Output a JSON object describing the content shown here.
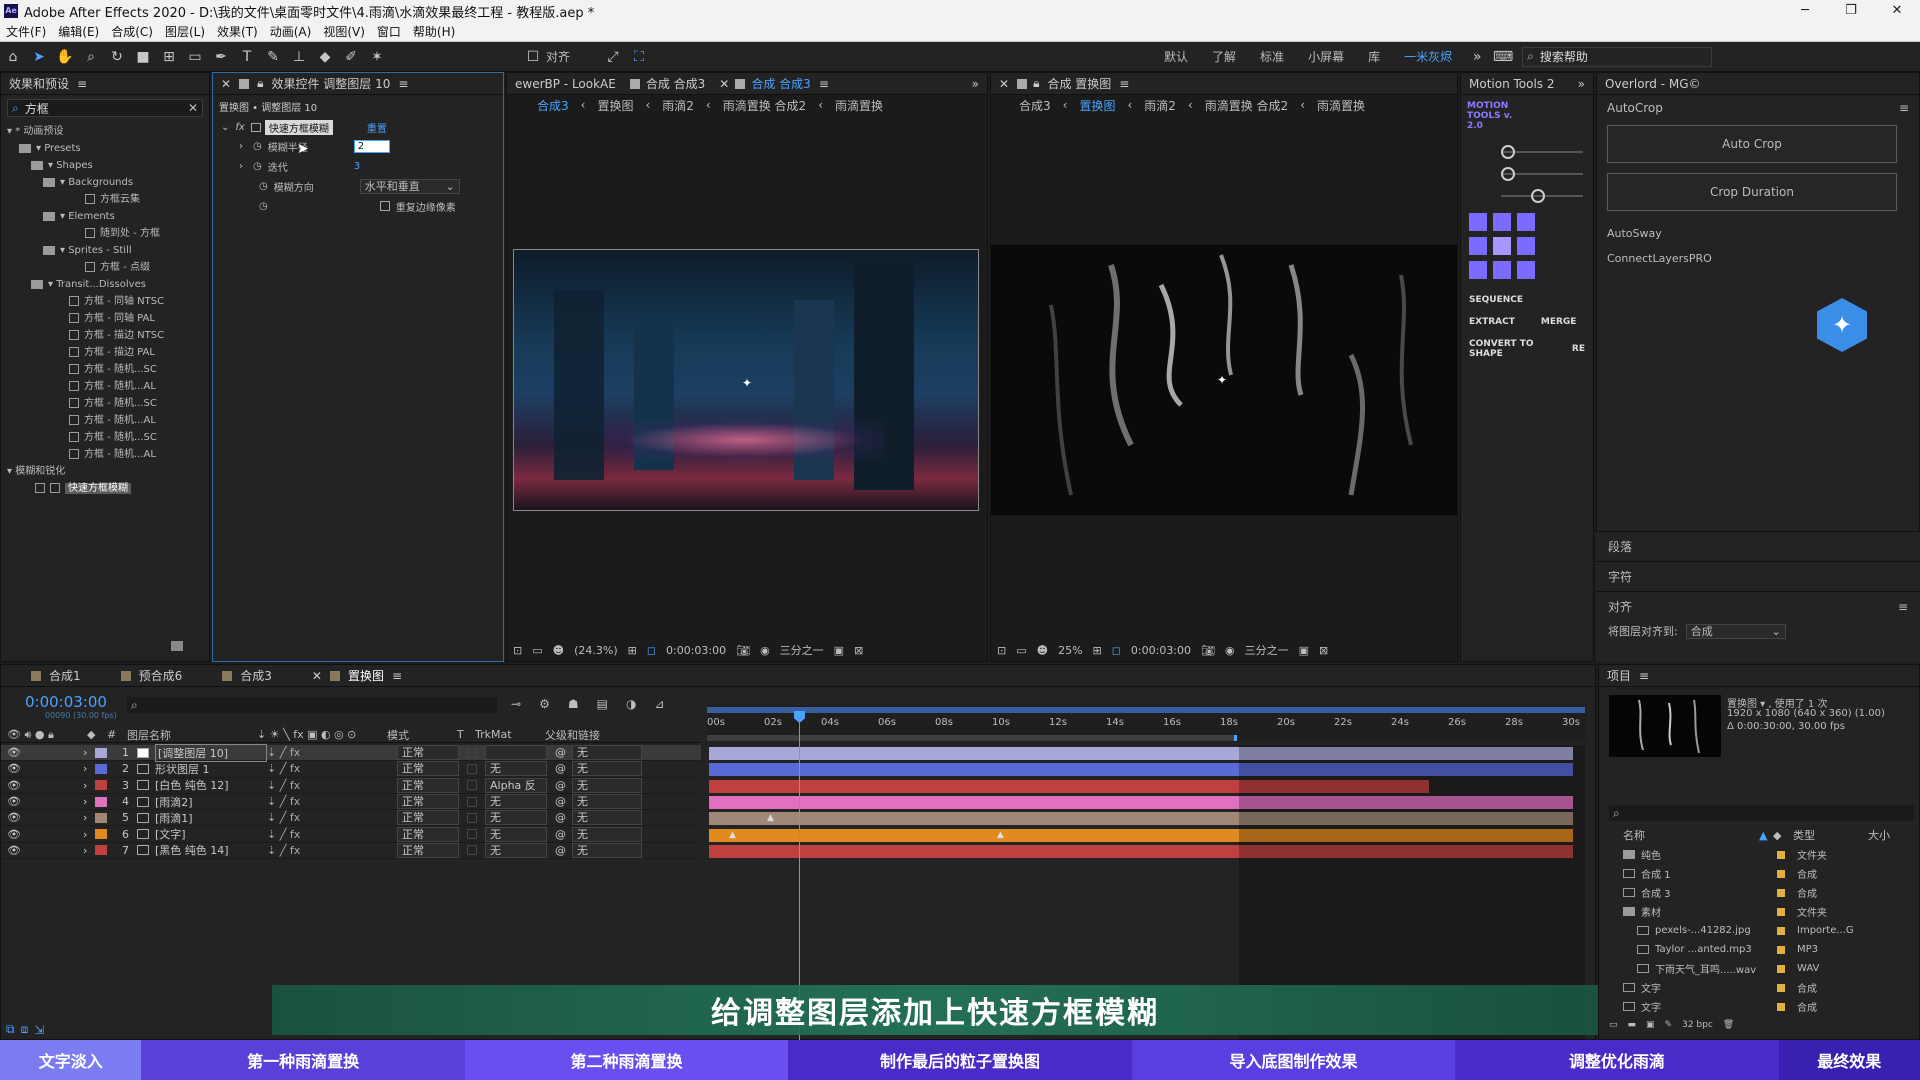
{
  "app": {
    "title": "Adobe After Effects 2020 - D:\\我的文件\\桌面零时文件\\4.雨滴\\水滴效果最终工程 - 教程版.aep *",
    "logo": "Ae"
  },
  "menu": [
    "文件(F)",
    "编辑(E)",
    "合成(C)",
    "图层(L)",
    "效果(T)",
    "动画(A)",
    "视图(V)",
    "窗口",
    "帮助(H)"
  ],
  "toolbar": {
    "align_label": "对齐",
    "workspaces": [
      "默认",
      "了解",
      "标准",
      "小屏幕",
      "库",
      "一米灰烬"
    ],
    "active_workspace": "一米灰烬",
    "search_placeholder": "搜索帮助"
  },
  "effects_panel": {
    "title": "效果和预设",
    "search_value": "方框",
    "tree": [
      "▾ * 动画预设",
      "▾ Presets",
      "▾ Shapes",
      "▾ Backgrounds",
      "方框云集",
      "▾ Elements",
      "随到处 - 方框",
      "▾ Sprites - Still",
      "方框 - 点缀",
      "▾ Transit...Dissolves",
      "方框 - 同轴 NTSC",
      "方框 - 同轴 PAL",
      "方框 - 描边 NTSC",
      "方框 - 描边 PAL",
      "方框 - 随机...SC",
      "方框 - 随机...AL",
      "方框 - 随机...SC",
      "方框 - 随机...AL",
      "方框 - 随机...SC",
      "方框 - 随机...AL",
      "▾ 模糊和锐化",
      "快速方框模糊"
    ]
  },
  "effect_controls": {
    "tab": "效果控件 调整图层 10",
    "path": "置换图 • 调整图层 10",
    "effect_name": "快速方框模糊",
    "reset": "重置",
    "props": [
      {
        "name": "模糊半径",
        "value": "2"
      },
      {
        "name": "迭代",
        "value": "3"
      },
      {
        "name": "模糊方向",
        "value": "水平和垂直"
      },
      {
        "name": "",
        "value": "重复边缘像素"
      }
    ]
  },
  "comp_viewer1": {
    "tabs": [
      "ewerBP - LookAE",
      "合成 合成3",
      "合成 合成3"
    ],
    "flow": [
      "合成3",
      "置换图",
      "雨滴2",
      "雨滴置换 合成2",
      "雨滴置换"
    ],
    "zoom": "(24.3%)",
    "time": "0:00:03:00",
    "res": "三分之一"
  },
  "comp_viewer2": {
    "tab": "合成 置换图",
    "flow": [
      "合成3",
      "置换图",
      "雨滴2",
      "雨滴置换 合成2",
      "雨滴置换"
    ],
    "zoom": "25%",
    "time": "0:00:03:00",
    "res": "三分之一"
  },
  "motion_tools": {
    "tab": "Motion Tools 2",
    "logo": "MOTION TOOLS v. 2.0",
    "buttons": [
      "SEQUENCE",
      "EXTRACT",
      "MERGE",
      "CONVERT TO SHAPE",
      "RE"
    ]
  },
  "overlord": {
    "tab": "Overlord - MG©",
    "autocrop": "AutoCrop",
    "btn1": "Auto Crop",
    "btn2": "Crop Duration",
    "items": [
      "AutoSway",
      "ConnectLayersPRO"
    ]
  },
  "right_panels": {
    "p1": "段落",
    "p2": "字符",
    "p3": "对齐",
    "align_to_label": "将图层对齐到:",
    "align_to_value": "合成"
  },
  "timeline": {
    "tabs": [
      "合成1",
      "预合成6",
      "合成3",
      "置换图"
    ],
    "timecode": "0:00:03:00",
    "frames": "00090 (30.00 fps)",
    "headers": [
      "图层名称",
      "模式",
      "T",
      "TrkMat",
      "父级和链接"
    ],
    "ruler": [
      "00s",
      "02s",
      "04s",
      "06s",
      "08s",
      "10s",
      "12s",
      "14s",
      "16s",
      "18s",
      "20s",
      "22s",
      "24s",
      "26s",
      "28s",
      "30s"
    ],
    "layers": [
      {
        "n": "1",
        "name": "[调整图层 10]",
        "mode": "正常",
        "trk": "",
        "parent": "无",
        "color": "#a8a8d8"
      },
      {
        "n": "2",
        "name": "形状图层 1",
        "mode": "正常",
        "trk": "无",
        "parent": "无",
        "color": "#5a6bd8"
      },
      {
        "n": "3",
        "name": "[白色 纯色 12]",
        "mode": "正常",
        "trk": "Alpha 反",
        "parent": "无",
        "color": "#c04040"
      },
      {
        "n": "4",
        "name": "[雨滴2]",
        "mode": "正常",
        "trk": "无",
        "parent": "无",
        "color": "#e070c0"
      },
      {
        "n": "5",
        "name": "[雨滴1]",
        "mode": "正常",
        "trk": "无",
        "parent": "无",
        "color": "#a08878"
      },
      {
        "n": "6",
        "name": "[文字]",
        "mode": "正常",
        "trk": "无",
        "parent": "无",
        "color": "#e08a20"
      },
      {
        "n": "7",
        "name": "[黑色 纯色 14]",
        "mode": "正常",
        "trk": "无",
        "parent": "无",
        "color": "#c04040"
      }
    ]
  },
  "project": {
    "tab": "项目",
    "item": "置换图 ▾ , 使用了 1 次",
    "info1": "1920 x 1080 (640 x 360) (1.00)",
    "info2": "Δ 0:00:30:00, 30.00 fps",
    "cols": [
      "名称",
      "类型",
      "大小"
    ],
    "items": [
      {
        "name": "纯色",
        "type": "文件夹"
      },
      {
        "name": "合成 1",
        "type": "合成"
      },
      {
        "name": "合成 3",
        "type": "合成"
      },
      {
        "name": "素材",
        "type": "文件夹"
      },
      {
        "name": "pexels-...41282.jpg",
        "type": "Importe...G"
      },
      {
        "name": "Taylor ...anted.mp3",
        "type": "MP3"
      },
      {
        "name": "下雨天气_耳鸣.....wav",
        "type": "WAV"
      },
      {
        "name": "文字",
        "type": "合成"
      },
      {
        "name": "文字",
        "type": "合成"
      }
    ],
    "bpc": "32 bpc"
  },
  "subtitle": "给调整图层添加上快速方框模糊",
  "chapters": [
    "文字淡入",
    "第一种雨滴置换",
    "第二种雨滴置换",
    "制作最后的粒子置换图",
    "导入底图制作效果",
    "调整优化雨滴",
    "最终效果"
  ]
}
